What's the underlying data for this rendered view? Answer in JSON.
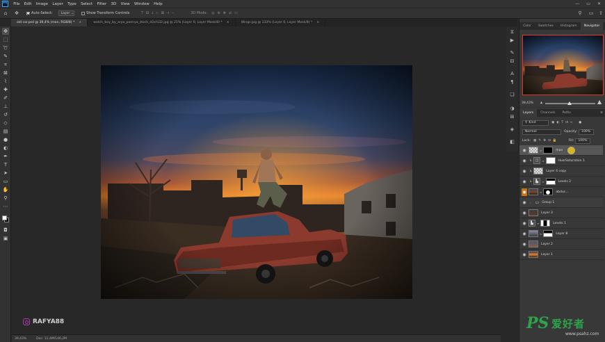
{
  "app": {
    "logo": "Ps",
    "menu": [
      "File",
      "Edit",
      "Image",
      "Layer",
      "Type",
      "Select",
      "Filter",
      "3D",
      "View",
      "Window",
      "Help"
    ],
    "window_controls": [
      "—",
      "▭",
      "✕"
    ]
  },
  "options_bar": {
    "auto_select_label": "Auto-Select:",
    "auto_select_target": "Layer",
    "show_transform_label": "Show Transform Controls",
    "mode_3d_label": "3D Mode:"
  },
  "tabs": [
    {
      "label": "old car.psd @ 39,4% (man, RGB/8) *",
      "active": true
    },
    {
      "label": "watch_boy_by_arya_poenya_stock_d2xhi32.jpg @ 21% (Layer 0, Layer Mask/8) *",
      "active": false
    },
    {
      "label": "Wings.jpg @ 133% (Layer 0, Layer Mask/8) *",
      "active": false
    }
  ],
  "icons": {
    "move": "move-icon",
    "artboard": "artboard-icon",
    "marquee": "marquee-icon",
    "lasso": "lasso-icon",
    "quick_select": "quick-select-icon",
    "crop": "crop-icon",
    "frame": "frame-icon",
    "eyedropper": "eyedropper-icon",
    "healing": "healing-brush-icon",
    "brush": "brush-icon",
    "stamp": "clone-stamp-icon",
    "history_brush": "history-brush-icon",
    "eraser": "eraser-icon",
    "gradient": "gradient-icon",
    "blur": "blur-icon",
    "dodge": "dodge-icon",
    "pen": "pen-icon",
    "type": "type-icon",
    "path_select": "path-selection-icon",
    "shape": "rectangle-icon",
    "hand": "hand-icon",
    "zoom": "zoom-icon",
    "more": "more-tools-icon"
  },
  "status": {
    "zoom": "39,43%",
    "doc": "Doc: 11,4M/146,2M"
  },
  "watermark_left": {
    "text": "RAFYA88"
  },
  "navigator": {
    "tabs": [
      "Color",
      "Swatches",
      "Histogram",
      "Navigator"
    ],
    "active_tab": "Navigator",
    "zoom": "39,43%",
    "zoom_level": 0.48
  },
  "layers_panel": {
    "tabs": [
      "Layers",
      "Channels",
      "Paths"
    ],
    "active_tab": "Layers",
    "filter_kind": "Kind",
    "blend_mode": "Normal",
    "opacity_label": "Opacity:",
    "opacity_value": "100%",
    "lock_label": "Lock:",
    "fill_label": "Fill:",
    "fill_value": "100%",
    "layers": [
      {
        "name": "man",
        "selected": true,
        "thumbs": [
          "checker",
          "black"
        ],
        "eye": "normal"
      },
      {
        "name": "Hue/Saturation 1",
        "clip": true,
        "thumbs": [
          "adj",
          "mask"
        ],
        "eye": "normal"
      },
      {
        "name": "Layer 4 copy",
        "clip": true,
        "thumbs": [
          "checker"
        ],
        "eye": "normal"
      },
      {
        "name": "Levels 2",
        "clip": true,
        "thumbs": [
          "adj",
          "mask-shape"
        ],
        "eye": "normal"
      },
      {
        "name": "abduc...",
        "thumbs": [
          "img",
          "black"
        ],
        "eye": "orange"
      },
      {
        "name": "Group 1",
        "group": true,
        "eye": "normal"
      },
      {
        "name": "Layer 3",
        "thumbs": [
          "img"
        ],
        "eye": "normal"
      },
      {
        "name": "Levels 1",
        "thumbs": [
          "adj",
          "mask-shape"
        ],
        "eye": "normal"
      },
      {
        "name": "Layer 8",
        "thumbs": [
          "img",
          "mask"
        ],
        "eye": "normal"
      },
      {
        "name": "Layer 2",
        "thumbs": [
          "img"
        ],
        "eye": "normal"
      },
      {
        "name": "Layer 1",
        "thumbs": [
          "img"
        ],
        "eye": "normal"
      }
    ]
  },
  "ps_watermark": {
    "ps": "PS",
    "cn": "爱好者",
    "url": "www.psahz.com"
  },
  "colors": {
    "accent_red": "#e23a2a",
    "orange_highlight": "#c8721a",
    "watermark_green": "#2ea34a"
  }
}
